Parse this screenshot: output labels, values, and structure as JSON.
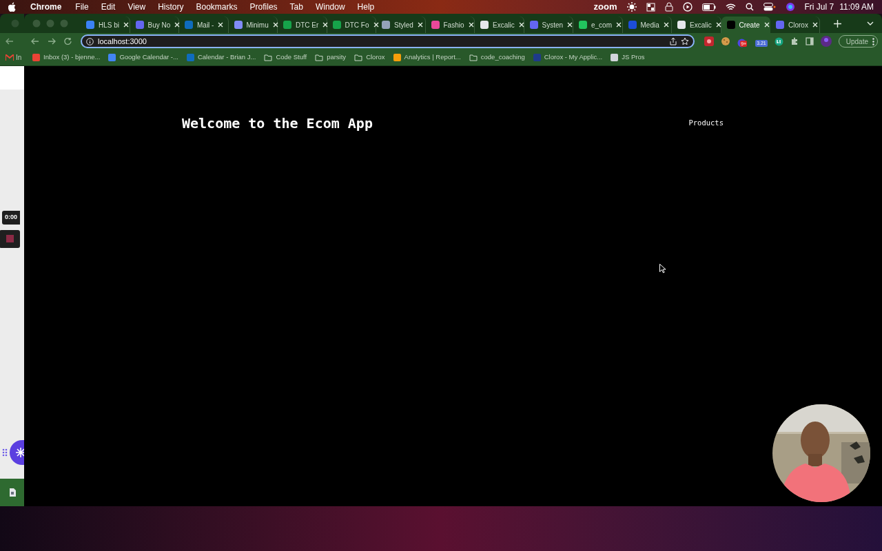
{
  "menu_bar": {
    "app": "Chrome",
    "items": [
      "File",
      "Edit",
      "View",
      "History",
      "Bookmarks",
      "Profiles",
      "Tab",
      "Window",
      "Help"
    ],
    "zoom_label": "zoom",
    "date": "Fri Jul 7",
    "time": "11:09 AM"
  },
  "background_window": {
    "bookmark": "In",
    "timer": "0:00"
  },
  "tabs": [
    {
      "title": "HLS bi",
      "color": "#3b82f6",
      "selected": false
    },
    {
      "title": "Buy No",
      "color": "#6366f1",
      "selected": false
    },
    {
      "title": "Mail - ",
      "color": "#0f6cbd",
      "selected": false
    },
    {
      "title": "Minimu",
      "color": "#818cf8",
      "selected": false
    },
    {
      "title": "DTC Er",
      "color": "#16a34a",
      "selected": false
    },
    {
      "title": "DTC Fo",
      "color": "#16a34a",
      "selected": false
    },
    {
      "title": "Styled",
      "color": "#94a3b8",
      "selected": false
    },
    {
      "title": "Fashio",
      "color": "#ec4899",
      "selected": false
    },
    {
      "title": "Excalic",
      "color": "#e5e7eb",
      "selected": false
    },
    {
      "title": "Systen",
      "color": "#6366f1",
      "selected": false
    },
    {
      "title": "e_com",
      "color": "#22c55e",
      "selected": false
    },
    {
      "title": "Media",
      "color": "#1d4ed8",
      "selected": false
    },
    {
      "title": "Excalic",
      "color": "#e5e7eb",
      "selected": false
    },
    {
      "title": "Create",
      "color": "#000000",
      "selected": true
    },
    {
      "title": "Clorox",
      "color": "#6366f1",
      "selected": false
    }
  ],
  "address_bar": {
    "url": "localhost:3000"
  },
  "extensions": {
    "badge_1": "9+",
    "badge_2": "3.21",
    "update_button": "Update"
  },
  "bookmarks": [
    {
      "label": "Inbox (3) - bjenne...",
      "kind": "site",
      "color": "#ea4335"
    },
    {
      "label": "Google Calendar -...",
      "kind": "site",
      "color": "#4285f4"
    },
    {
      "label": "Calendar - Brian J...",
      "kind": "site",
      "color": "#0f6cbd"
    },
    {
      "label": "Code Stuff",
      "kind": "folder"
    },
    {
      "label": "parsity",
      "kind": "folder"
    },
    {
      "label": "Clorox",
      "kind": "folder"
    },
    {
      "label": "Analytics | Report...",
      "kind": "site",
      "color": "#f59e0b"
    },
    {
      "label": "code_coaching",
      "kind": "folder"
    },
    {
      "label": "Clorox - My Applic...",
      "kind": "site",
      "color": "#1e3a8a"
    },
    {
      "label": "JS Pros",
      "kind": "site",
      "color": "#d1d5db"
    }
  ],
  "page": {
    "heading": "Welcome to the Ecom App",
    "nav_link": "Products"
  }
}
